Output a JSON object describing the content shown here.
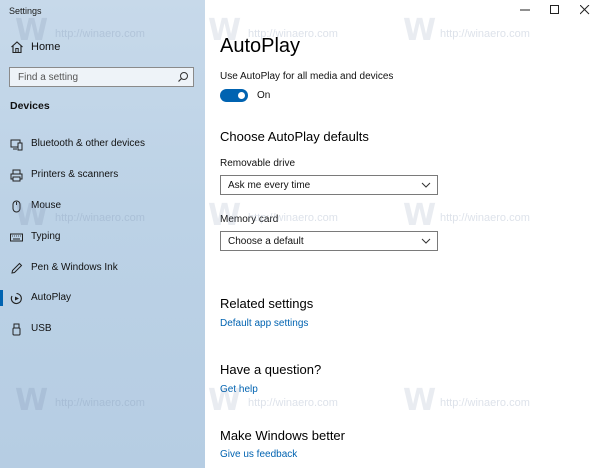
{
  "window": {
    "title": "Settings"
  },
  "sidebar": {
    "home_label": "Home",
    "search_placeholder": "Find a setting",
    "section_header": "Devices",
    "items": [
      {
        "label": "Bluetooth & other devices",
        "icon": "bluetooth-icon"
      },
      {
        "label": "Printers & scanners",
        "icon": "printer-icon"
      },
      {
        "label": "Mouse",
        "icon": "mouse-icon"
      },
      {
        "label": "Typing",
        "icon": "keyboard-icon"
      },
      {
        "label": "Pen & Windows Ink",
        "icon": "pen-icon"
      },
      {
        "label": "AutoPlay",
        "icon": "autoplay-icon",
        "selected": true
      },
      {
        "label": "USB",
        "icon": "usb-icon"
      }
    ]
  },
  "main": {
    "title": "AutoPlay",
    "use_autoplay_label": "Use AutoPlay for all media and devices",
    "toggle_state": "On",
    "defaults_header": "Choose AutoPlay defaults",
    "removable_drive_label": "Removable drive",
    "removable_drive_value": "Ask me every time",
    "memory_card_label": "Memory card",
    "memory_card_value": "Choose a default",
    "related_header": "Related settings",
    "related_link": "Default app settings",
    "question_header": "Have a question?",
    "question_link": "Get help",
    "better_header": "Make Windows better",
    "better_link": "Give us feedback"
  },
  "watermark": {
    "text": "http://winaero.com"
  },
  "colors": {
    "accent": "#0063b1",
    "sidebar_bg": "#bcd2e6"
  }
}
